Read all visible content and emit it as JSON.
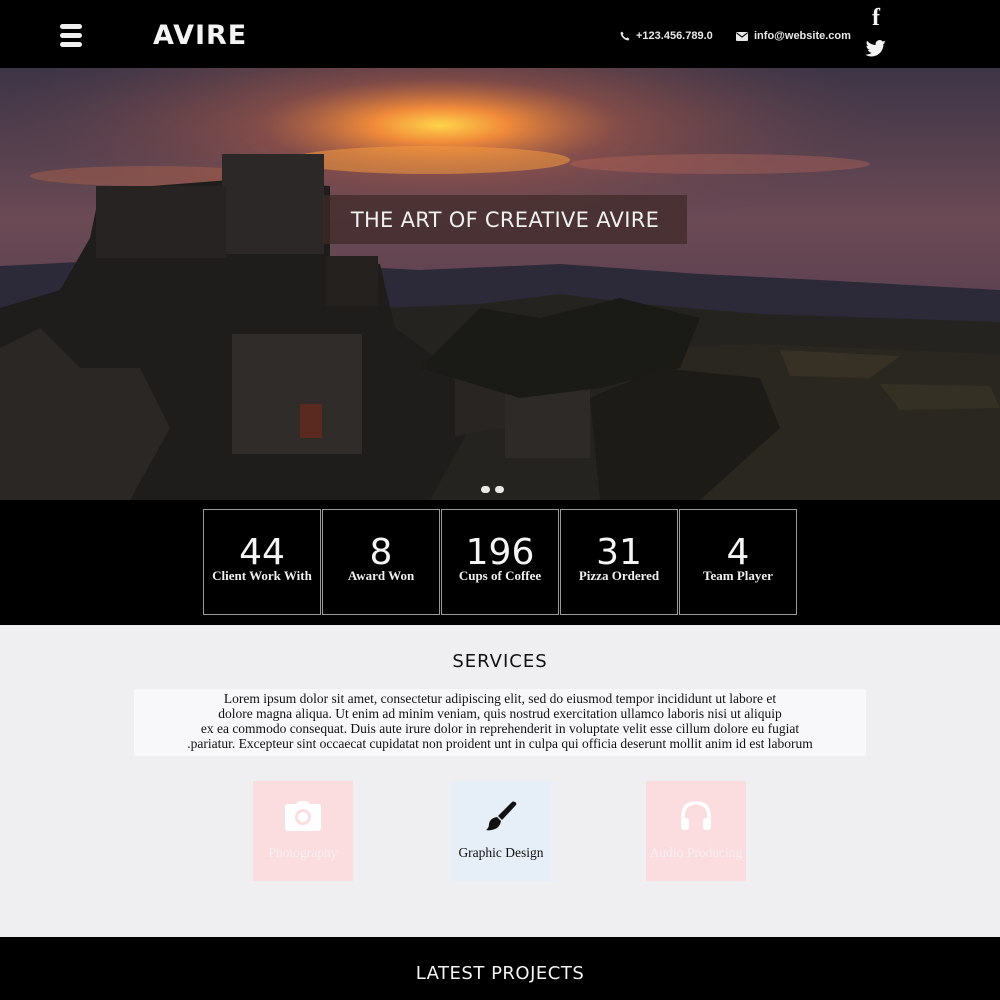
{
  "header": {
    "logo": "AVIRE",
    "phone": "+123.456.789.0",
    "email": "info@website.com",
    "icons": {
      "menu": "hamburger-menu-icon",
      "phone": "phone-icon",
      "email": "envelope-icon",
      "facebook": "facebook-icon",
      "twitter": "twitter-icon"
    },
    "facebook_glyph": "f"
  },
  "hero": {
    "title": "THE ART OF CREATIVE AVIRE",
    "slides": 2
  },
  "stats": [
    {
      "value": "44",
      "label": "Client Work With"
    },
    {
      "value": "8",
      "label": "Award Won"
    },
    {
      "value": "196",
      "label": "Cups of Coffee"
    },
    {
      "value": "31",
      "label": "Pizza Ordered"
    },
    {
      "value": "4",
      "label": "Team Player"
    }
  ],
  "services": {
    "title": "SERVICES",
    "text_lines": [
      "Lorem ipsum dolor sit amet, consectetur adipiscing elit, sed do eiusmod tempor incididunt ut labore et",
      "dolore magna aliqua. Ut enim ad minim veniam, quis nostrud exercitation ullamco laboris nisi ut aliquip",
      "ex ea commodo consequat. Duis aute irure dolor in reprehenderit in voluptate velit esse cillum dolore eu fugiat",
      ".pariatur. Excepteur sint occaecat cupidatat non proident unt in culpa qui officia deserunt mollit anim id est laborum"
    ],
    "items": [
      {
        "label": "Photography",
        "icon": "camera-icon"
      },
      {
        "label": "Graphic Design",
        "icon": "paintbrush-icon"
      },
      {
        "label": "Audio Producing",
        "icon": "headphones-icon"
      }
    ]
  },
  "projects": {
    "title": "LATEST PROJECTS"
  },
  "colors": {
    "header_bg": "#000000",
    "services_bg": "#efeff1",
    "card_pink": "#fbdde0",
    "card_blue": "#e6eef8"
  }
}
